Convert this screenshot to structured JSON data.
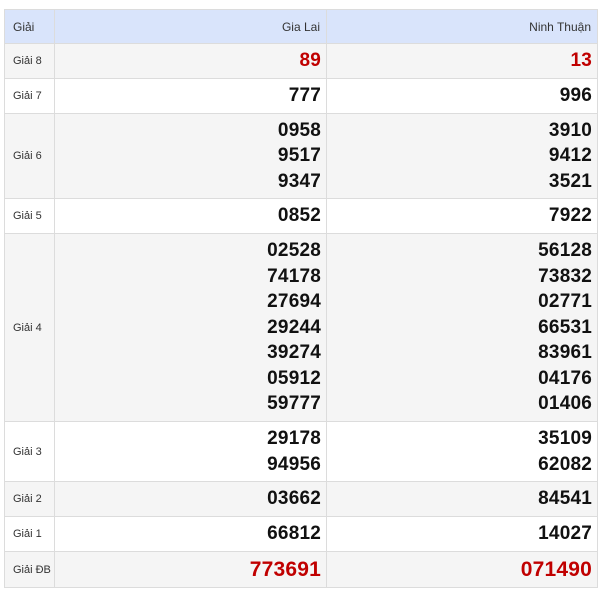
{
  "header": {
    "label_col": "Giải",
    "provinces": [
      "Gia Lai",
      "Ninh Thuận"
    ]
  },
  "prizes": [
    {
      "label": "Giải 8",
      "gia_lai": [
        "89"
      ],
      "ninh_thuan": [
        "13"
      ],
      "highlight": "#c00000"
    },
    {
      "label": "Giải 7",
      "gia_lai": [
        "777"
      ],
      "ninh_thuan": [
        "996"
      ]
    },
    {
      "label": "Giải 6",
      "gia_lai": [
        "0958",
        "9517",
        "9347"
      ],
      "ninh_thuan": [
        "3910",
        "9412",
        "3521"
      ]
    },
    {
      "label": "Giải 5",
      "gia_lai": [
        "0852"
      ],
      "ninh_thuan": [
        "7922"
      ]
    },
    {
      "label": "Giải 4",
      "gia_lai": [
        "02528",
        "74178",
        "27694",
        "29244",
        "39274",
        "05912",
        "59777"
      ],
      "ninh_thuan": [
        "56128",
        "73832",
        "02771",
        "66531",
        "83961",
        "04176",
        "01406"
      ]
    },
    {
      "label": "Giải 3",
      "gia_lai": [
        "29178",
        "94956"
      ],
      "ninh_thuan": [
        "35109",
        "62082"
      ]
    },
    {
      "label": "Giải 2",
      "gia_lai": [
        "03662"
      ],
      "ninh_thuan": [
        "84541"
      ]
    },
    {
      "label": "Giải 1",
      "gia_lai": [
        "66812"
      ],
      "ninh_thuan": [
        "14027"
      ]
    },
    {
      "label": "Giải ĐB",
      "gia_lai": [
        "773691"
      ],
      "ninh_thuan": [
        "071490"
      ],
      "highlight": "#c00000"
    }
  ]
}
